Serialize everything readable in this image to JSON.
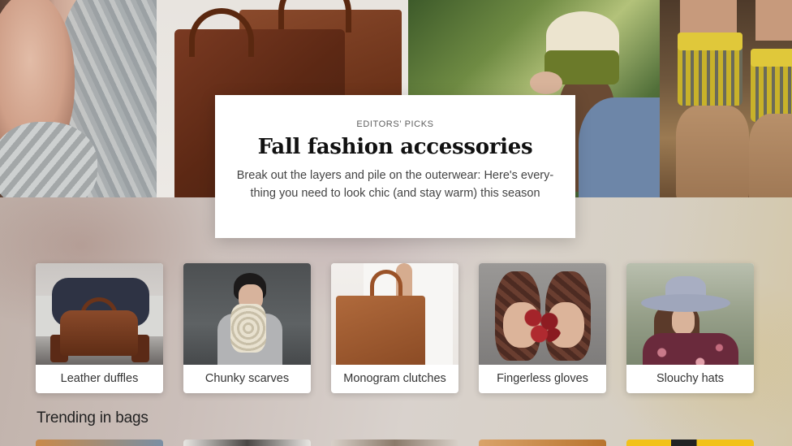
{
  "featured": {
    "eyebrow": "EDITORS’ PICKS",
    "title": "Fall fashion accessories",
    "description": "Break out the layers and pile on the outerwear: Here's every-thing you need to look chic (and stay warm) this season",
    "photos": [
      "chunky-knit-scarf-photo",
      "leather-tote-photo",
      "knit-beanie-photo",
      "wool-socks-boots-photo"
    ]
  },
  "categories": [
    {
      "label": "Leather duffles",
      "image": "leather-duffle-photo"
    },
    {
      "label": "Chunky scarves",
      "image": "chunky-scarf-photo"
    },
    {
      "label": "Monogram clutches",
      "image": "tote-bag-photo"
    },
    {
      "label": "Fingerless gloves",
      "image": "fingerless-gloves-photo"
    },
    {
      "label": "Slouchy hats",
      "image": "slouchy-hat-photo"
    }
  ],
  "sections": [
    {
      "title": "Trending in bags"
    }
  ],
  "colors": {
    "card_background": "#ffffff",
    "title_text": "#111111",
    "body_text": "#444444"
  }
}
